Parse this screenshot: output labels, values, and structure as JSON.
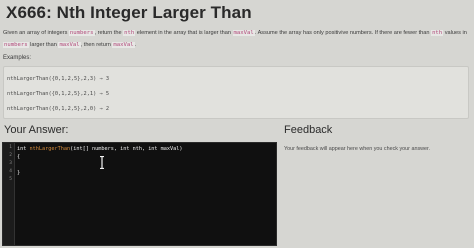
{
  "problem": {
    "title": "X666: Nth Integer Larger Than",
    "description": {
      "p1": "Given an array of integers ",
      "c1": "numbers",
      "p2": ", return the ",
      "c2": "nth",
      "p3": " element in the array that is larger than ",
      "c3": "maxVal",
      "p4": ". Assume the array has only positivive numbers. If there are fewer than ",
      "c4": "nth",
      "p5": " values in ",
      "c5": "numbers",
      "p6": " larger than ",
      "c6": "maxVal",
      "p7": ", then return ",
      "c7": "maxVal",
      "p8": "."
    },
    "examples_label": "Examples:",
    "examples": [
      "nthLargerThan({0,1,2,5},2,3) → 3",
      "nthLargerThan({0,1,2,5},2,1) → 5",
      "nthLargerThan({0,1,2,5},2,0) → 2"
    ]
  },
  "answer": {
    "title": "Your Answer:",
    "line_numbers": [
      "1",
      "2",
      "3",
      "4",
      "5"
    ],
    "code": {
      "l1_type": "int ",
      "l1_fn": "nthLargerThan",
      "l1_rest": "(int[] numbers, int nth, int maxVal)",
      "l2": "{",
      "l3": "",
      "l4": "}",
      "l5": ""
    }
  },
  "feedback": {
    "title": "Feedback",
    "placeholder": "Your feedback will appear here when you check your answer."
  }
}
